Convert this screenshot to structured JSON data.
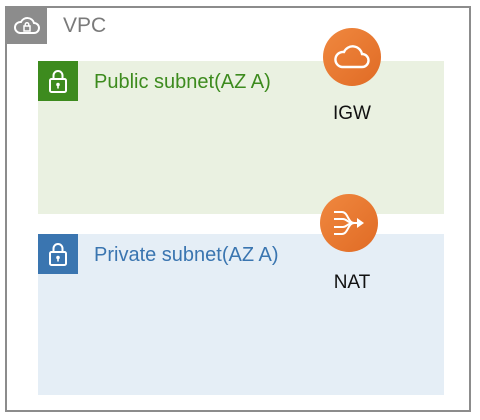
{
  "vpc": {
    "label": "VPC",
    "icon": "cloud-lock-icon"
  },
  "subnets": [
    {
      "label": "Public subnet(AZ A)",
      "icon": "lock-icon",
      "color": "#3d8b1e"
    },
    {
      "label": "Private subnet(AZ A)",
      "icon": "lock-icon",
      "color": "#3a75b0"
    }
  ],
  "services": [
    {
      "label": "IGW",
      "icon": "cloud-icon",
      "color": "#e8772e"
    },
    {
      "label": "NAT",
      "icon": "nat-gateway-icon",
      "color": "#e8772e"
    }
  ]
}
